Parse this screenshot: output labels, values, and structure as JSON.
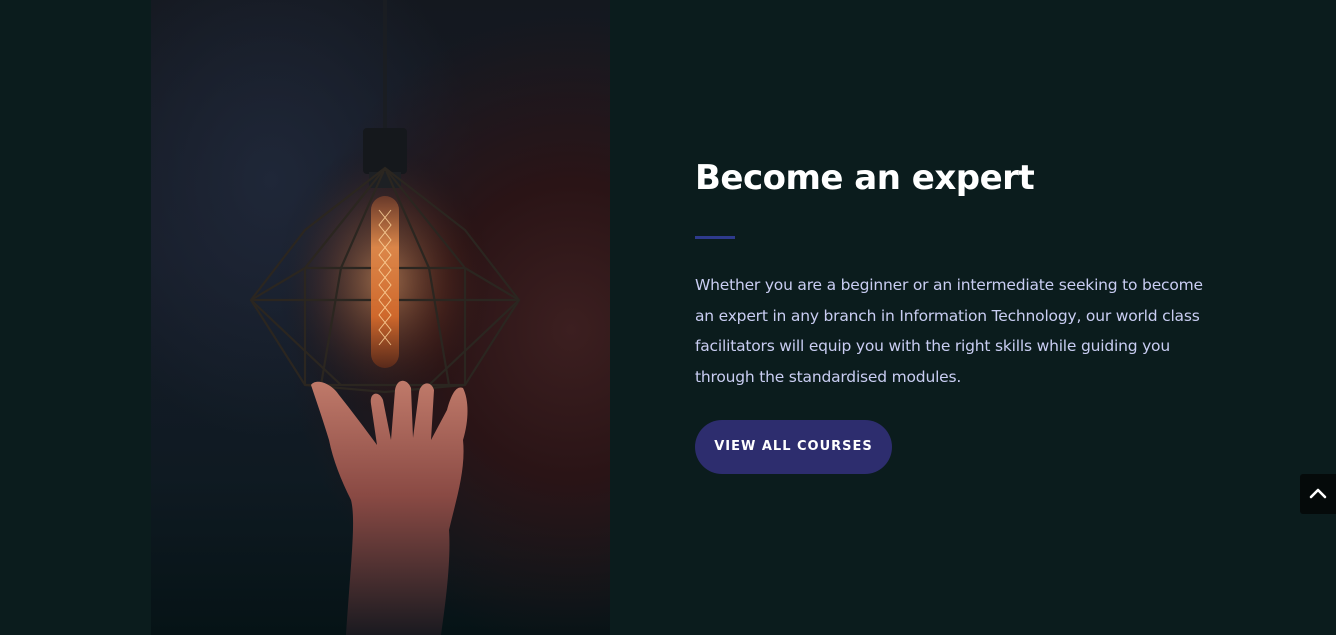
{
  "hero": {
    "image_subject": "lamp-in-hand-photo",
    "heading": "Become an expert",
    "body": "Whether you are a beginner or an intermediate seeking to become an expert in any branch in Information Technology, our world class facilitators will equip you with the right skills while guiding you through the  standardised modules.",
    "cta_label": "VIEW ALL COURSES"
  },
  "scroll_top": {
    "icon": "chevron-up-icon"
  },
  "colors": {
    "background": "#0b1c1d",
    "heading": "#ffffff",
    "body_text": "#c9cdf2",
    "accent": "#2e3a8c",
    "button": "#2d2d6e",
    "scroll_button": "#050a0a"
  }
}
